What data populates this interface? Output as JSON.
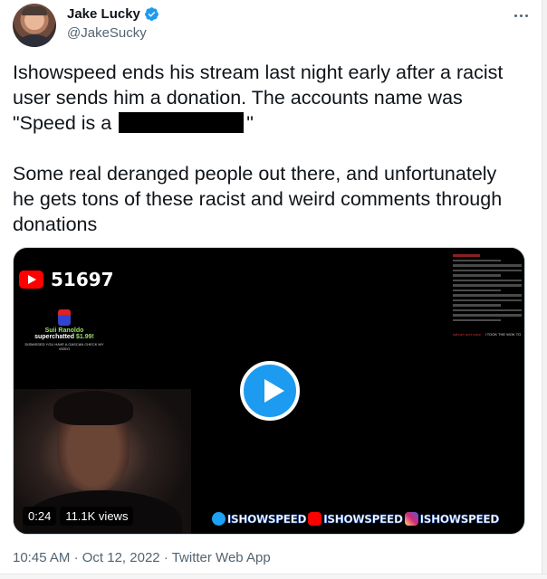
{
  "author": {
    "display_name": "Jake Lucky",
    "handle": "@JakeSucky",
    "verified": true,
    "avatar_icon": "avatar-photo"
  },
  "tweet": {
    "paragraph1_before": "Ishowspeed ends his stream last night early after a racist user sends him a donation. The accounts name was \"Speed is a",
    "paragraph1_after": "\"",
    "paragraph2": "Some real deranged people out there, and unfortunately he gets tons of these racist and weird comments through donations"
  },
  "media": {
    "type": "video",
    "duration": "0:24",
    "views": "11.1K views",
    "overlay_count": "51697",
    "superchat_name": "Suii Ranoldo",
    "superchat_text": "superchatted",
    "superchat_amount": "$1.99!",
    "superchat_message": "DISMISSED YOU HAVE A GASCAN CHECK MY VIDEO",
    "chat_name_1": "kabuzh and voice",
    "chat_text_1": "I TOOK THE WOK TO",
    "social_handle": "ISHOWSPEED",
    "play_color": "#1d9bf0"
  },
  "footer": {
    "time": "10:45 AM",
    "separator": "·",
    "date": "Oct 12, 2022",
    "source": "Twitter Web App"
  }
}
